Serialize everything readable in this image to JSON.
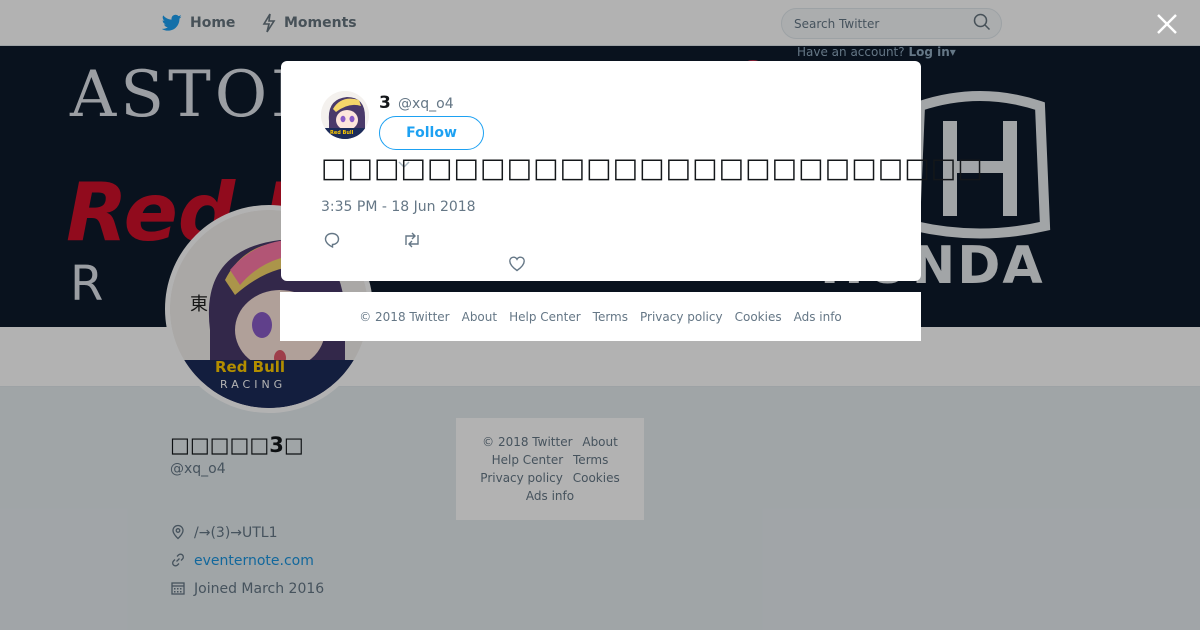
{
  "nav": {
    "home_label": "Home",
    "moments_label": "Moments",
    "search_placeholder": "Search Twitter",
    "account_prompt": "Have an account?",
    "login_label": "Log in",
    "brand_color": "#1da1f2",
    "icons": [
      "twitter-bird-icon",
      "lightning-icon",
      "search-icon",
      "caret-down-icon",
      "close-icon"
    ]
  },
  "banner": {
    "text_top": "ASTON",
    "text_mid": "Red B",
    "text_bottom": "R",
    "text_right": "HONDA"
  },
  "profile": {
    "name": "□□□□□3□",
    "handle": "@xq_o4",
    "location": "/→(3)→UTL1",
    "url": "eventernote.com",
    "joined": "Joined March 2016"
  },
  "sidebar_footer": {
    "items": [
      "© 2018 Twitter",
      "About",
      "Help Center",
      "Terms",
      "Privacy policy",
      "Cookies",
      "Ads info"
    ]
  },
  "modal": {
    "display_name": "3",
    "handle": "@xq_o4",
    "follow_label": "Follow",
    "tweet_text": "□□□□□□□□□□□□□□□□□□□□□□□□□",
    "timestamp": "3:35 PM - 18 Jun 2018"
  },
  "modal_footer": {
    "items": [
      "© 2018 Twitter",
      "About",
      "Help Center",
      "Terms",
      "Privacy policy",
      "Cookies",
      "Ads info"
    ]
  }
}
